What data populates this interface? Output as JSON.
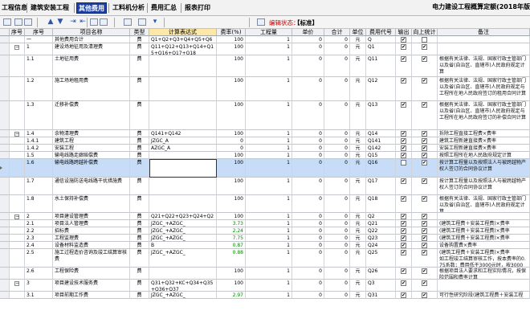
{
  "tabs": [
    {
      "label": "工程信息",
      "active": false
    },
    {
      "label": "建筑安装工程",
      "active": false
    },
    {
      "label": "其他费用",
      "active": true
    },
    {
      "label": "工料机分析",
      "active": false
    },
    {
      "label": "费用汇总",
      "active": false
    },
    {
      "label": "报表打印",
      "active": false
    }
  ],
  "app_title": "电力建设工程概算定额(2018年版",
  "toolbar": {
    "icons": [
      "table-icon",
      "insert-row-icon",
      "delete-row-icon",
      "move-up-icon",
      "move-down-icon",
      "indent-icon",
      "outdent-icon",
      "copy-icon",
      "paste-icon",
      "fill-color-icon",
      "filter-icon",
      "arrow-down-icon",
      "calculator-icon"
    ],
    "edit_state_label": "编辑状态：",
    "edit_mode": "【标准】"
  },
  "columns": [
    "序号",
    "序号",
    "项目名称",
    "类型",
    "计算表达式",
    "费率(%)",
    "工程量",
    "单价",
    "合计",
    "单位",
    "费用代号",
    "输出",
    "向上统计",
    "备注"
  ],
  "rows": [
    {
      "tree": "",
      "no": "一",
      "name": "其他费用合计",
      "type": "费",
      "formula": "Q1+Q2+Q3+Q4+Q5+Q6",
      "rate": "100",
      "qty": "1",
      "price": "0",
      "total": "0",
      "unit": "元",
      "code": "Q",
      "output": true,
      "up": false,
      "remark": ""
    },
    {
      "tree": "−",
      "no": "1",
      "name": "建设场地征用及清理费",
      "type": "费",
      "formula": "Q11+Q12+Q13+Q14+Q15+Q16+Q17+Q18",
      "rate": "100",
      "qty": "1",
      "price": "0",
      "total": "0",
      "unit": "元",
      "code": "Q1",
      "output": true,
      "up": true,
      "remark": ""
    },
    {
      "tree": "",
      "no": "1.1",
      "name": "土地征用费",
      "type": "费",
      "formula": "",
      "rate": "100",
      "qty": "1",
      "price": "0",
      "total": "0",
      "unit": "元",
      "code": "Q11",
      "output": true,
      "up": true,
      "remark": "根据有关法律、法规、国家行政主管部门以及省(自治区、直辖市)人民政府规定计算"
    },
    {
      "tree": "",
      "no": "1.2",
      "name": "施工场地租用费",
      "type": "费",
      "formula": "",
      "rate": "100",
      "qty": "1",
      "price": "0",
      "total": "0",
      "unit": "元",
      "code": "Q12",
      "output": true,
      "up": true,
      "remark": "根据有关法律、法规、国家行政主管部门以及省(自治区、直辖市)人民政府规定与工程所在地人民政府签订的租用合同计算"
    },
    {
      "tree": "",
      "no": "1.3",
      "name": "迁移补偿费",
      "type": "费",
      "formula": "",
      "rate": "100",
      "qty": "1",
      "price": "0",
      "total": "0",
      "unit": "元",
      "code": "Q13",
      "output": true,
      "up": true,
      "remark": "根据有关法律、法规、国家行政主管部门以及省(自治区、直辖市)人民政府规定与工程所在地人民政府签订的补偿合同计算"
    },
    {
      "tree": "−",
      "no": "1.4",
      "name": "余物清理费",
      "type": "费",
      "formula": "Q141+Q142",
      "rate": "100",
      "qty": "1",
      "price": "0",
      "total": "0",
      "unit": "元",
      "code": "Q14",
      "output": true,
      "up": true,
      "remark": "拆除工程直接工程费×费率"
    },
    {
      "tree": "",
      "no": "1.4.1",
      "name": "建筑工程",
      "type": "费",
      "formula": "JZGC_A",
      "rate": "0",
      "qty": "1",
      "price": "0",
      "total": "0",
      "unit": "元",
      "code": "Q141",
      "output": true,
      "up": true,
      "remark": "建筑工程新建直接费×费率"
    },
    {
      "tree": "",
      "no": "1.4.2",
      "name": "安装工程",
      "type": "费",
      "formula": "AZGC_A",
      "rate": "0",
      "qty": "1",
      "price": "0",
      "total": "0",
      "unit": "元",
      "code": "Q142",
      "output": true,
      "up": true,
      "remark": "安装工程新建直接费×费率"
    },
    {
      "tree": "",
      "no": "1.5",
      "name": "输电线路走廊赔偿费",
      "type": "费",
      "formula": "",
      "rate": "100",
      "qty": "1",
      "price": "0",
      "total": "0",
      "unit": "元",
      "code": "Q15",
      "output": true,
      "up": true,
      "remark": "按照工程所在地人民政府规定计算"
    },
    {
      "tree": "",
      "no": "1.6",
      "name": "输电线路跨越补偿费",
      "type": "费",
      "formula": "",
      "rate": "100",
      "qty": "1",
      "price": "0",
      "total": "0",
      "unit": "元",
      "code": "Q16",
      "output": false,
      "up": true,
      "remark": "按计算工程量以及按照法人与被跨越物产权人签订的合同协议计算",
      "selected": true
    },
    {
      "tree": "",
      "no": "1.7",
      "name": "通信设施防送电线路干扰措施费",
      "type": "费",
      "formula": "",
      "rate": "100",
      "qty": "1",
      "price": "0",
      "total": "0",
      "unit": "元",
      "code": "Q17",
      "output": true,
      "up": true,
      "remark": "按计算工程量以及按照法人与被跨越物产权人签订的合同协议计算"
    },
    {
      "tree": "",
      "no": "1.8",
      "name": "水土保持补偿费",
      "type": "费",
      "formula": "",
      "rate": "100",
      "qty": "1",
      "price": "0",
      "total": "0",
      "unit": "元",
      "code": "Q18",
      "output": true,
      "up": true,
      "remark": "根据有关法律、法规、国家行政主管部门以及省(自治区、直辖市)人民政府规定计算"
    },
    {
      "tree": "−",
      "no": "2",
      "name": "项目建设管理费",
      "type": "费",
      "formula": "Q21+Q22+Q23+Q24+Q25+Q26",
      "rate": "100",
      "qty": "1",
      "price": "0",
      "total": "0",
      "unit": "元",
      "code": "Q2",
      "output": true,
      "up": true,
      "remark": ""
    },
    {
      "tree": "",
      "no": "2.1",
      "name": "项目法人管理费",
      "type": "费",
      "formula": "JZGC_+AZGC_",
      "rate": "3.73",
      "qty": "1",
      "price": "0",
      "total": "0",
      "unit": "元",
      "code": "Q21",
      "output": true,
      "up": true,
      "remark": "(建筑工程费＋安装工程费)×费率"
    },
    {
      "tree": "",
      "no": "2.2",
      "name": "招标费",
      "type": "费",
      "formula": "JZGC_+AZGC_",
      "rate": "2.24",
      "qty": "1",
      "price": "0",
      "total": "0",
      "unit": "元",
      "code": "Q22",
      "output": true,
      "up": true,
      "remark": "(建筑工程费＋安装工程费)×费率"
    },
    {
      "tree": "",
      "no": "2.3",
      "name": "工程监理费",
      "type": "费",
      "formula": "JZGC_+AZGC_",
      "rate": "7.75",
      "qty": "1",
      "price": "0",
      "total": "0",
      "unit": "元",
      "code": "Q23",
      "output": true,
      "up": true,
      "remark": "(建筑工程费＋安装工程费)×费率"
    },
    {
      "tree": "",
      "no": "2.4",
      "name": "设备材料监造费",
      "type": "费",
      "formula": "B",
      "rate": "0.87",
      "qty": "1",
      "price": "0",
      "total": "0",
      "unit": "元",
      "code": "Q24",
      "output": true,
      "up": true,
      "remark": "设备购置费×费率"
    },
    {
      "tree": "",
      "no": "2.5",
      "name": "施工过程造价咨询及竣工结算审核费",
      "type": "费",
      "formula": "JZGC_+AZGC_",
      "rate": "0.88",
      "qty": "1",
      "price": "0",
      "total": "0",
      "unit": "元",
      "code": "Q25",
      "output": true,
      "up": true,
      "remark": "(建筑工程费＋安装工程费)×费率\n如工程竣工结算审核工作，按本费率的0.75系数；费用低于3000元时，按3000元计列。"
    },
    {
      "tree": "",
      "no": "2.6",
      "name": "工程保险费",
      "type": "费",
      "formula": "",
      "rate": "100",
      "qty": "1",
      "price": "0",
      "total": "0",
      "unit": "元",
      "code": "Q26",
      "output": true,
      "up": true,
      "remark": "根据项目法人要求和工程实际情况，按保险范围和费率计算"
    },
    {
      "tree": "−",
      "no": "3",
      "name": "项目建设技术服务费",
      "type": "费",
      "formula": "Q31+Q32+KC+Q34+Q35+Q36+Q37",
      "rate": "100",
      "qty": "1",
      "price": "0",
      "total": "0",
      "unit": "元",
      "code": "Q3",
      "output": true,
      "up": true,
      "remark": ""
    },
    {
      "tree": "",
      "no": "3.1",
      "name": "项目前期工作费",
      "type": "费",
      "formula": "JZGC_+AZGC_",
      "rate": "2.97",
      "qty": "1",
      "price": "0",
      "total": "0",
      "unit": "元",
      "code": "Q31",
      "output": true,
      "up": true,
      "remark": "可行性研究阶段(建筑工程费＋安装工程费)×费率"
    }
  ]
}
